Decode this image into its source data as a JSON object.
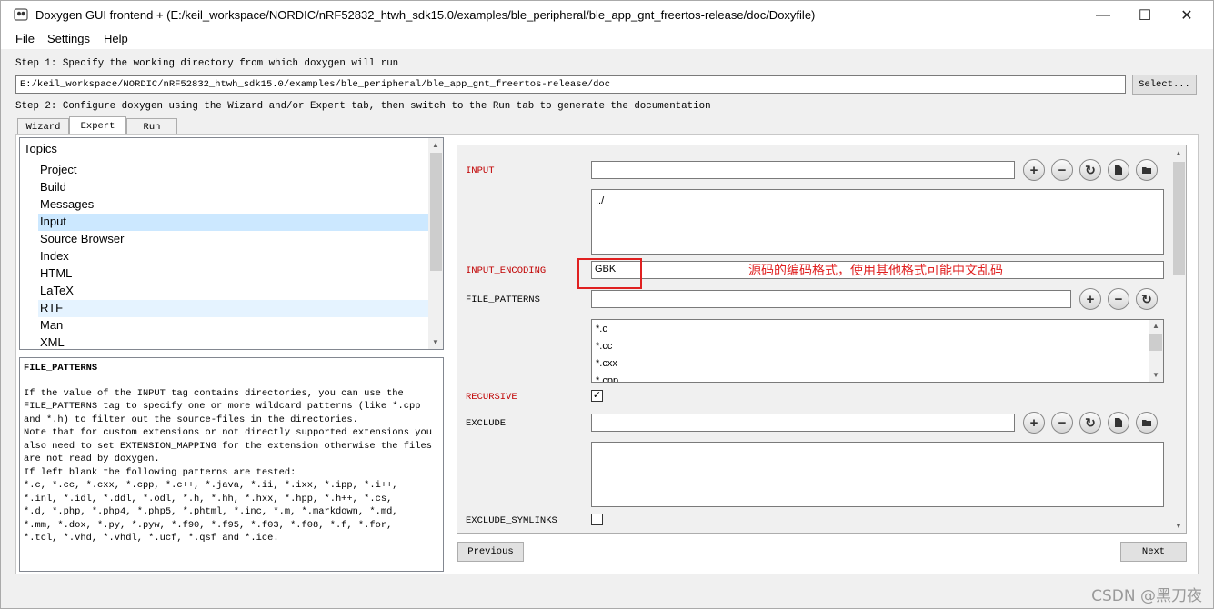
{
  "window": {
    "title": "Doxygen GUI frontend + (E:/keil_workspace/NORDIC/nRF52832_htwh_sdk15.0/examples/ble_peripheral/ble_app_gnt_freertos-release/doc/Doxyfile)",
    "minimize": "—",
    "maximize": "☐",
    "close": "✕"
  },
  "menu": [
    "File",
    "Settings",
    "Help"
  ],
  "step1": {
    "label": "Step 1: Specify the working directory from which doxygen will run",
    "path": "E:/keil_workspace/NORDIC/nRF52832_htwh_sdk15.0/examples/ble_peripheral/ble_app_gnt_freertos-release/doc",
    "select_button": "Select..."
  },
  "step2": {
    "label": "Step 2: Configure doxygen using the Wizard and/or Expert tab, then switch to the Run tab to generate the documentation"
  },
  "tabs": [
    "Wizard",
    "Expert",
    "Run"
  ],
  "topics": {
    "header": "Topics",
    "items": [
      "Project",
      "Build",
      "Messages",
      "Input",
      "Source Browser",
      "Index",
      "HTML",
      "LaTeX",
      "RTF",
      "Man",
      "XML"
    ],
    "selected": "Input"
  },
  "help": {
    "title": "FILE_PATTERNS",
    "lines": [
      "If the value of the INPUT tag contains directories, you can use the",
      "FILE_PATTERNS tag to specify one or more wildcard patterns (like *.cpp",
      "and *.h) to filter out the source-files in the directories.",
      "Note that for custom extensions or not directly supported extensions you",
      "also need to set EXTENSION_MAPPING for the extension otherwise the files",
      "are not read by doxygen.",
      "If left blank the following patterns are tested:",
      "*.c, *.cc, *.cxx, *.cpp, *.c++, *.java, *.ii, *.ixx, *.ipp, *.i++,",
      "*.inl, *.idl, *.ddl, *.odl, *.h, *.hh, *.hxx, *.hpp, *.h++, *.cs,",
      "*.d, *.php, *.php4, *.php5, *.phtml, *.inc, *.m, *.markdown, *.md,",
      "*.mm, *.dox, *.py, *.pyw, *.f90, *.f95, *.f03, *.f08, *.f, *.for,",
      "*.tcl, *.vhd, *.vhdl, *.ucf, *.qsf and *.ice."
    ]
  },
  "form": {
    "input": {
      "label": "INPUT",
      "value": "",
      "list": [
        "../"
      ]
    },
    "input_encoding": {
      "label": "INPUT_ENCODING",
      "value": "GBK"
    },
    "file_patterns": {
      "label": "FILE_PATTERNS",
      "value": "",
      "list": [
        "*.c",
        "*.cc",
        "*.cxx",
        "*.cpp"
      ]
    },
    "recursive": {
      "label": "RECURSIVE",
      "checked": true
    },
    "exclude": {
      "label": "EXCLUDE",
      "value": ""
    },
    "exclude_symlinks": {
      "label": "EXCLUDE_SYMLINKS",
      "checked": false
    },
    "icons": {
      "add": "+",
      "remove": "−",
      "refresh": "↻"
    }
  },
  "annotation": "源码的编码格式，使用其他格式可能中文乱码",
  "nav": {
    "previous": "Previous",
    "next": "Next"
  },
  "watermark": "CSDN @黑刀夜",
  "colors": {
    "required_label": "#c00000",
    "annotation": "#e02020",
    "selection": "#cce8ff"
  }
}
